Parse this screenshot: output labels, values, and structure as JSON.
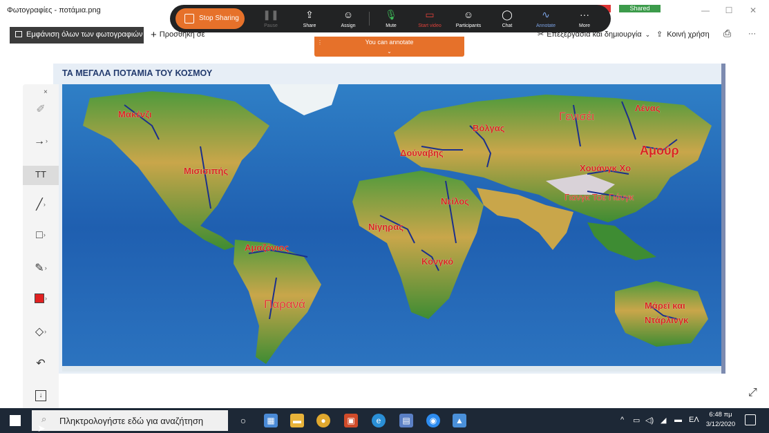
{
  "window": {
    "title": "Φωτογραφίες - ποτάμια.png",
    "minimize_label": "—",
    "maximize_label": "☐",
    "close_label": "✕"
  },
  "photos_toolbar": {
    "view_all_label": "Εμφάνιση όλων των φωτογραφιών",
    "add_label": "Προσθήκη σε",
    "edit_create_label": "Επεξεργασία και δημιουργία",
    "share_label": "Κοινή χρήση",
    "print_icon": "printer-icon",
    "more_label": "···"
  },
  "zoom_toolbar": {
    "stop_sharing_label": "Stop Sharing",
    "tools": [
      {
        "label": "Pause",
        "icon": "pause-icon",
        "glyph": "❚❚"
      },
      {
        "label": "Share",
        "icon": "share-icon",
        "glyph": "⇪"
      },
      {
        "label": "Assign",
        "icon": "person-icon",
        "glyph": "☺"
      },
      {
        "label": "Mute",
        "icon": "microphone-icon",
        "glyph": "🎙"
      },
      {
        "label": "Start video",
        "icon": "video-off-icon",
        "glyph": "▭"
      },
      {
        "label": "Participants",
        "icon": "participants-icon",
        "glyph": "☺"
      },
      {
        "label": "Chat",
        "icon": "chat-icon",
        "glyph": "◯"
      },
      {
        "label": "Annotate",
        "icon": "annotate-icon",
        "glyph": "∿"
      },
      {
        "label": "More",
        "icon": "more-icon",
        "glyph": "···"
      }
    ],
    "shared_badge": "Shared",
    "annotate_banner": "You can annotate",
    "accent_color": "#e6712a"
  },
  "map": {
    "title": "ΤΑ ΜΕΓΑΛΑ ΠΟΤΑΜΙΑ ΤΟΥ ΚΟΣΜΟΥ",
    "labels": [
      "Μακένζι",
      "Μισισιπής",
      "Αμαζόνιος",
      "Παρανά",
      "Δούναβης",
      "Βόλγας",
      "Νείλος",
      "Νίγηρας",
      "Κονγκό",
      "Γενισέι",
      "Λένας",
      "Αμούρ",
      "Χουάνγκ Χο",
      "Γιανγκ Τσε Γιάνγκ",
      "Μάρεϊ και",
      "Ντάρλινγκ"
    ],
    "label_color": "#d8261f"
  },
  "annotation_palette": {
    "close_label": "×",
    "tools": [
      "select-icon",
      "arrow-icon",
      "text-icon",
      "line-icon",
      "rectangle-icon",
      "pen-icon",
      "color-swatch",
      "eraser-icon",
      "undo-icon",
      "save-icon"
    ],
    "text_tool_label": "TT",
    "selected_color": "#e02020"
  },
  "taskbar": {
    "search_placeholder": "Πληκτρολογήστε εδώ για αναζήτηση",
    "language": "ΕΛ",
    "time": "6:48 πμ",
    "date": "3/12/2020"
  }
}
